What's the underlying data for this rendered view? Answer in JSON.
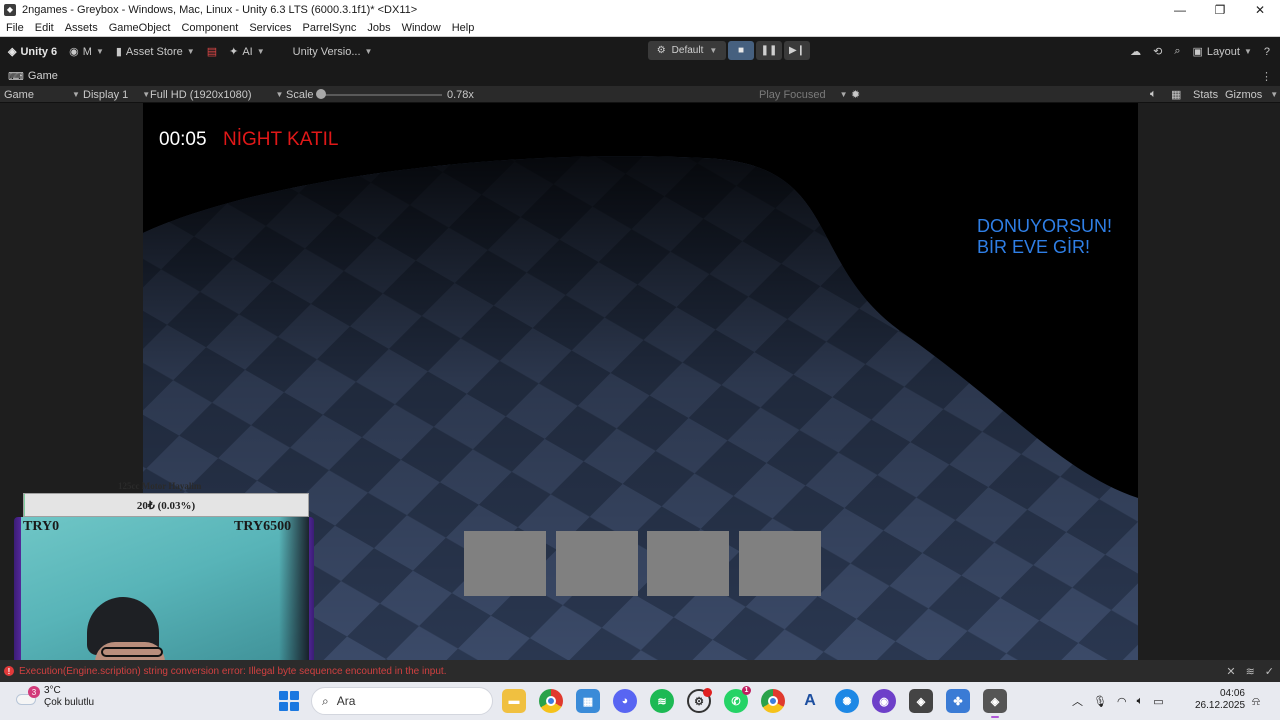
{
  "window": {
    "title": "2ngames - Greybox - Windows, Mac, Linux - Unity 6.3 LTS (6000.3.1f1)* <DX11>",
    "controls": [
      "—",
      "❐",
      "✕"
    ]
  },
  "menu": [
    "File",
    "Edit",
    "Assets",
    "GameObject",
    "Component",
    "Services",
    "ParrelSync",
    "Jobs",
    "Window",
    "Help"
  ],
  "toolbar": {
    "unity_label": "Unity 6",
    "account_label": "M",
    "asset_store_label": "Asset Store",
    "ai_label": "AI",
    "version_control_label": "Unity Versio...",
    "layout_mode_label": "Default",
    "layout_label": "Layout"
  },
  "tab": {
    "label": "Game"
  },
  "gamebar": {
    "view_label": "Game",
    "display_label": "Display 1",
    "resolution_label": "Full HD (1920x1080)",
    "scale_label": "Scale",
    "scale_value": "0.78x",
    "play_focused_label": "Play Focused",
    "stats_label": "Stats",
    "gizmos_label": "Gizmos"
  },
  "game": {
    "timer": "00:05",
    "mode": "NİGHT KATIL",
    "message_line1": "DONUYORSUN!",
    "message_line2": "BİR EVE GİR!",
    "slot_count": 4
  },
  "overlay": {
    "goal_label": "125cc Motor Hayalim",
    "progress_text": "20₺ (0.03%)",
    "progress_percent": 0.03,
    "min_label": "TRY0",
    "max_label": "TRY6500"
  },
  "console": {
    "error_text": "Execution(Engine.scription) string conversion error: Illegal byte sequence encounted in the input."
  },
  "taskbar": {
    "weather_badge": "3",
    "temperature": "3°C",
    "weather_desc": "Çok bulutlu",
    "search_placeholder": "Ara",
    "time": "04:06",
    "date": "26.12.2025",
    "whatsapp_badge": "1"
  },
  "colors": {
    "timer": "#ffffff",
    "mode": "#e01818",
    "message": "#2f7fe6",
    "slot": "#808080",
    "console_error": "#d04040"
  }
}
